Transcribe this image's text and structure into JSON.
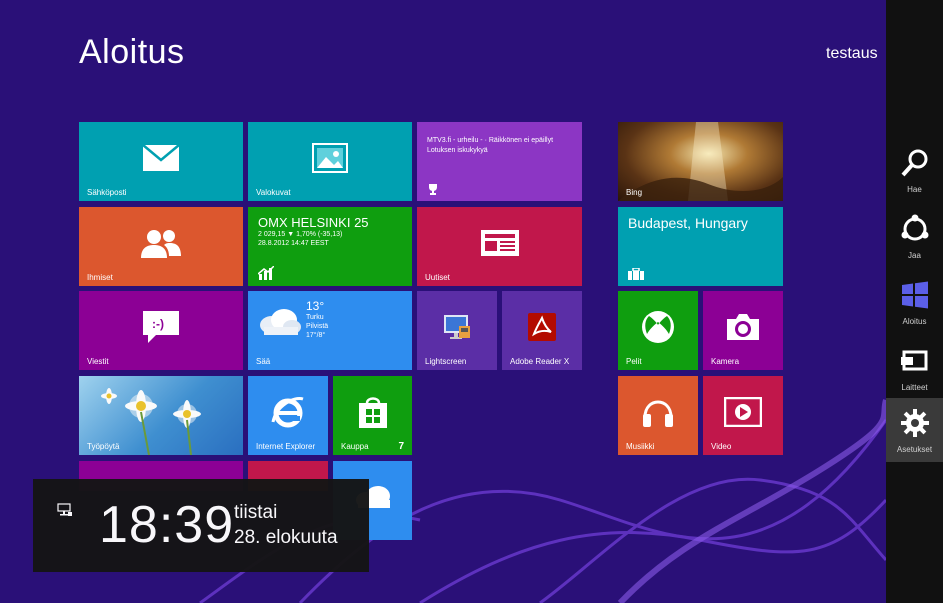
{
  "start": {
    "title": "Aloitus",
    "user": "testaus"
  },
  "tiles": {
    "mail": {
      "label": "Sähköposti",
      "color": "#00a0b1"
    },
    "photos": {
      "label": "Valokuvat",
      "color": "#00a0b1"
    },
    "news_mtv": {
      "headline": "MTV3.fi - urheilu - · Räikkönen ei epäillyt Lotuksen iskukykyä",
      "color": "#8c36c4"
    },
    "bing": {
      "label": "Bing"
    },
    "people": {
      "label": "Ihmiset",
      "color": "#dc572e"
    },
    "finance": {
      "title": "OMX HELSINKI 25",
      "line1": "2 029,15 ▼ 1,70% (-35,13)",
      "line2": "28.8.2012 14:47 EEST",
      "color": "#0f9e0f"
    },
    "news": {
      "label": "Uutiset",
      "color": "#c1174b"
    },
    "travel": {
      "label": "Budapest, Hungary",
      "color": "#00a0b1"
    },
    "messaging": {
      "label": "Viestit",
      "color": "#8c0095"
    },
    "weather": {
      "label": "Sää",
      "temp": "13°",
      "city": "Turku",
      "cond": "Pilvistä",
      "range": "17°/8°",
      "color": "#2e8def"
    },
    "lightscreen": {
      "label": "Lightscreen",
      "color": "#5b2ea6"
    },
    "adobe": {
      "label": "Adobe Reader X",
      "color": "#5b2ea6"
    },
    "games": {
      "label": "Pelit",
      "color": "#0f9e0f"
    },
    "camera": {
      "label": "Kamera",
      "color": "#8c0095"
    },
    "desktop": {
      "label": "Työpöytä"
    },
    "ie": {
      "label": "Internet Explorer",
      "color": "#2e8def"
    },
    "store": {
      "label": "Kauppa",
      "count": "7",
      "color": "#0f9e0f"
    },
    "music": {
      "label": "Musiikki",
      "color": "#dc572e"
    },
    "video": {
      "label": "Video",
      "color": "#c1174b"
    }
  },
  "charms": [
    {
      "label": "Hae",
      "icon": "search-icon"
    },
    {
      "label": "Jaa",
      "icon": "share-icon"
    },
    {
      "label": "Aloitus",
      "icon": "windows-logo-icon"
    },
    {
      "label": "Laitteet",
      "icon": "devices-icon"
    },
    {
      "label": "Asetukset",
      "icon": "gear-icon"
    }
  ],
  "clock": {
    "time": "18:39",
    "day": "tiistai",
    "date": "28. elokuuta"
  }
}
